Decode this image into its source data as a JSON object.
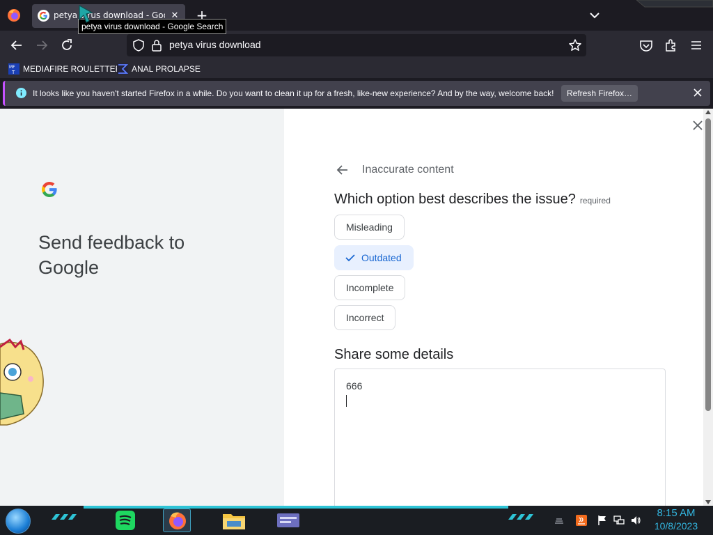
{
  "browser": {
    "tab": {
      "title": "petya virus download - Google Search",
      "favicon": "google-g-icon"
    },
    "tooltip": "petya virus download - Google Search",
    "url": "petya virus download",
    "bookmarks": [
      {
        "label": "MEDIAFIRE ROULETTER",
        "icon": "mediafire-icon"
      },
      {
        "label": "ANAL PROLAPSE",
        "icon": "sigma-icon"
      }
    ],
    "notification": {
      "text": "It looks like you haven't started Firefox in a while. Do you want to clean it up for a fresh, like-new experience? And by the way, welcome back!",
      "button": "Refresh Firefox…"
    }
  },
  "feedback": {
    "panel_title": "Send feedback to Google",
    "section": "Inaccurate content",
    "question": "Which option best describes the issue?",
    "required_label": "required",
    "options": [
      {
        "label": "Misleading",
        "selected": false
      },
      {
        "label": "Outdated",
        "selected": true
      },
      {
        "label": "Incomplete",
        "selected": false
      },
      {
        "label": "Incorrect",
        "selected": false
      }
    ],
    "details_title": "Share some details",
    "details_value": "666"
  },
  "taskbar": {
    "clock_time": "8:15 AM",
    "clock_date": "10/8/2023",
    "apps": [
      "spotify-icon",
      "firefox-icon",
      "file-explorer-icon",
      "window-manager-icon"
    ],
    "accent_color": "#2ec4d6"
  },
  "colors": {
    "selected_chip_bg": "#e8f0fe",
    "selected_chip_text": "#1967d2",
    "notification_accent": "#c552ff"
  }
}
